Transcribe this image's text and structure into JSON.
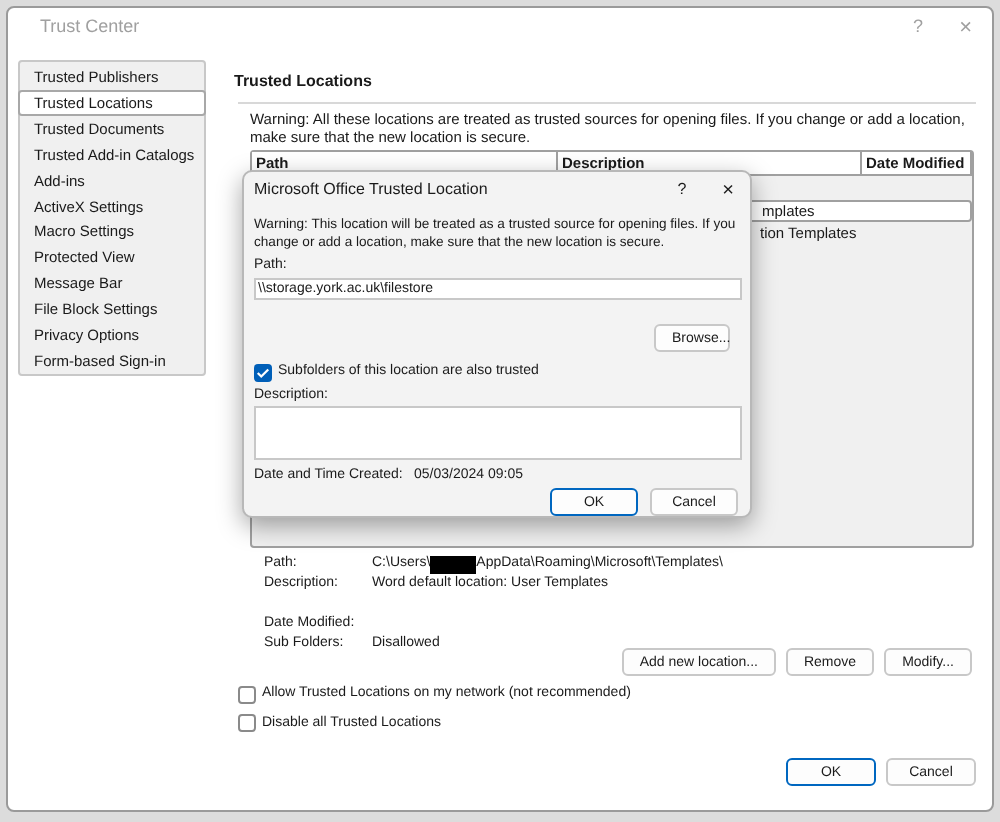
{
  "window": {
    "title": "Trust Center",
    "help": "?",
    "close": "×"
  },
  "sidebar": {
    "items": [
      {
        "label": "Trusted Publishers",
        "selected": false
      },
      {
        "label": "Trusted Locations",
        "selected": true
      },
      {
        "label": "Trusted Documents",
        "selected": false
      },
      {
        "label": "Trusted Add-in Catalogs",
        "selected": false
      },
      {
        "label": "Add-ins",
        "selected": false
      },
      {
        "label": "ActiveX Settings",
        "selected": false
      },
      {
        "label": "Macro Settings",
        "selected": false
      },
      {
        "label": "Protected View",
        "selected": false
      },
      {
        "label": "Message Bar",
        "selected": false
      },
      {
        "label": "File Block Settings",
        "selected": false
      },
      {
        "label": "Privacy Options",
        "selected": false
      },
      {
        "label": "Form-based Sign-in",
        "selected": false
      }
    ]
  },
  "main": {
    "heading": "Trusted Locations",
    "warning": "Warning: All these locations are treated as trusted sources for opening files.  If you change or add a location, make sure that the new location is secure.",
    "table": {
      "columns": [
        "Path",
        "Description",
        "Date Modified"
      ],
      "rows": [
        {
          "description": "mplates",
          "selected": true
        },
        {
          "description": "tion Templates",
          "selected": false
        }
      ]
    },
    "details": [
      {
        "label": "Path:",
        "value": "C:\\Users\\",
        "value_end": "AppData\\Roaming\\Microsoft\\Templates\\"
      },
      {
        "label": "Description:",
        "value": "Word default location: User Templates"
      },
      {
        "label": "Date Modified:"
      },
      {
        "label": "Sub Folders:",
        "value": "Disallowed"
      }
    ],
    "buttons": [
      "Add new location...",
      "Remove",
      "Modify..."
    ],
    "options": [
      {
        "label": "Allow Trusted Locations on my network (not recommended)",
        "checked": false
      },
      {
        "label": "Disable all Trusted Locations",
        "checked": false
      }
    ]
  },
  "footer_buttons": [
    "OK",
    "Cancel"
  ],
  "dialog": {
    "title": "Microsoft Office Trusted Location",
    "help": "?",
    "close": "×",
    "warning": "Warning: This location will be treated as a trusted source for opening files. If you change or add a location, make sure that the new location is secure.",
    "path_label": "Path:",
    "path_value": "\\\\storage.york.ac.uk\\filestore",
    "browse": "Browse...",
    "subfolders": {
      "label": "Subfolders of this location are also trusted",
      "checked": true
    },
    "description_label": "Description:",
    "created_label": "Date and Time Created:",
    "created_value": "05/03/2024 09:05",
    "buttons": [
      "OK",
      "Cancel"
    ]
  }
}
